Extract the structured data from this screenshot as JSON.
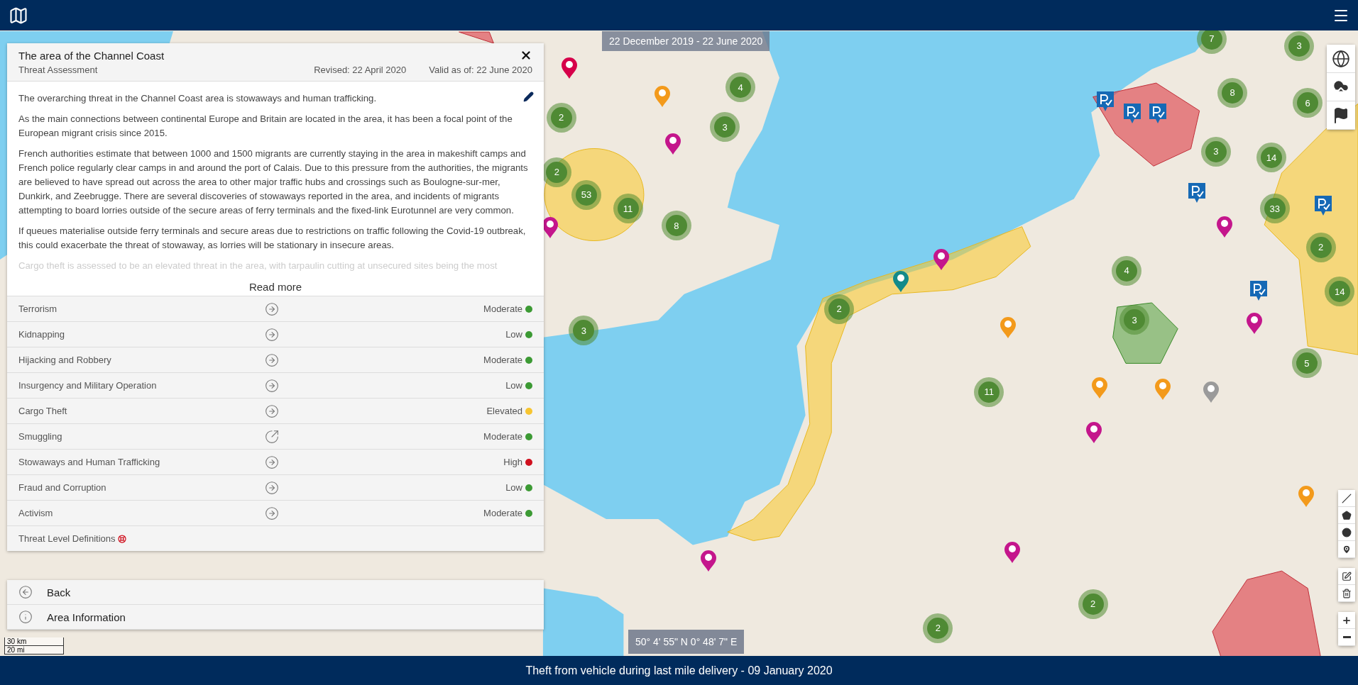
{
  "date_range": "22 December 2019 - 22 June 2020",
  "panel": {
    "title": "The area of the Channel Coast",
    "subtitle": "Threat Assessment",
    "revised": "Revised: 22 April 2020",
    "valid_as_of": "Valid as of: 22 June 2020",
    "paragraphs": [
      "The overarching threat in the Channel Coast area is stowaways and human trafficking.",
      "As the main connections between continental Europe and Britain are located in the area, it has been a focal point of the European migrant crisis since 2015.",
      "French authorities estimate that between 1000 and 1500 migrants are currently staying in the area in makeshift camps and French police regularly clear camps in and around the port of Calais. Due to this pressure from the authorities, the migrants are believed to have spread out across the area to other major traffic hubs and crossings such as Boulogne-sur-mer, Dunkirk, and Zeebrugge. There are several discoveries of stowaways reported in the area, and incidents of migrants attempting to board lorries outside of the secure areas of ferry terminals and the fixed-link Eurotunnel are very common.",
      "If queues materialise outside ferry terminals and secure areas due to restrictions on traffic following the Covid-19 outbreak, this could exacerbate the threat of stowaway, as lorries will be stationary in insecure areas."
    ],
    "faded_line": "Cargo theft is assessed to be an elevated threat in the area, with tarpaulin cutting at unsecured sites being the most",
    "read_more": "Read more",
    "threats": [
      {
        "name": "Terrorism",
        "kind": "steady",
        "level": "Moderate",
        "color": "#3c9a34"
      },
      {
        "name": "Kidnapping",
        "kind": "steady",
        "level": "Low",
        "color": "#3c9a34"
      },
      {
        "name": "Hijacking and Robbery",
        "kind": "steady",
        "level": "Moderate",
        "color": "#3c9a34"
      },
      {
        "name": "Insurgency and Military Operation",
        "kind": "steady",
        "level": "Low",
        "color": "#3c9a34"
      },
      {
        "name": "Cargo Theft",
        "kind": "steady",
        "level": "Elevated",
        "color": "#f7c531"
      },
      {
        "name": "Smuggling",
        "kind": "rising",
        "level": "Moderate",
        "color": "#3c9a34"
      },
      {
        "name": "Stowaways and Human Trafficking",
        "kind": "steady",
        "level": "High",
        "color": "#d0101e"
      },
      {
        "name": "Fraud and Corruption",
        "kind": "steady",
        "level": "Low",
        "color": "#3c9a34"
      },
      {
        "name": "Activism",
        "kind": "steady",
        "level": "Moderate",
        "color": "#3c9a34"
      }
    ],
    "definitions": "Threat Level Definitions"
  },
  "nav": [
    {
      "label": "Back",
      "kind": "back"
    },
    {
      "label": "Area Information",
      "kind": "info"
    }
  ],
  "clusters": [
    "7",
    "3",
    "4",
    "8",
    "6",
    "3",
    "2",
    "2",
    "53",
    "11",
    "8",
    "3",
    "14",
    "33",
    "2",
    "4",
    "14",
    "2",
    "3",
    "3",
    "5",
    "11",
    "2",
    "2"
  ],
  "scale": [
    "30 km",
    "20 mi"
  ],
  "coordinates": "50° 4' 55\" N 0° 48' 7\" E",
  "status_bar": "Theft from vehicle during last mile delivery - 09 January 2020"
}
